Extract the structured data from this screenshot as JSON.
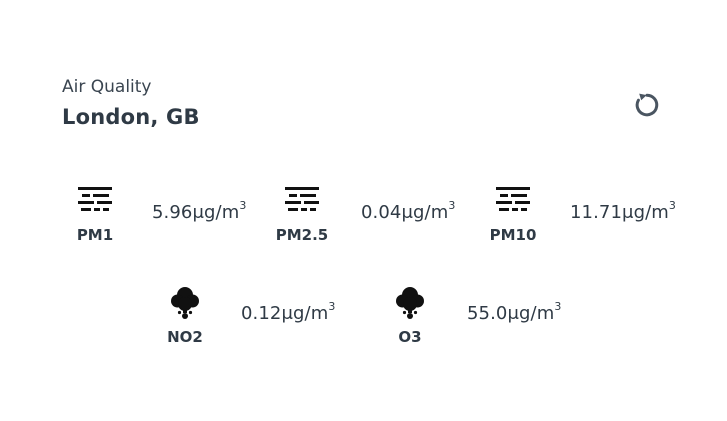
{
  "header": {
    "subtitle": "Air Quality",
    "location": "London, GB",
    "refresh_icon": "refresh-icon"
  },
  "metrics": [
    {
      "label": "PM1",
      "value": "5.96",
      "unit": "μg/m",
      "unit_sup": "3",
      "icon": "haze-icon"
    },
    {
      "label": "PM2.5",
      "value": "0.04",
      "unit": "μg/m",
      "unit_sup": "3",
      "icon": "haze-icon"
    },
    {
      "label": "PM10",
      "value": "11.71",
      "unit": "μg/m",
      "unit_sup": "3",
      "icon": "haze-icon"
    },
    {
      "label": "NO2",
      "value": "0.12",
      "unit": "μg/m",
      "unit_sup": "3",
      "icon": "smoke-cloud-icon"
    },
    {
      "label": "O3",
      "value": "55.0",
      "unit": "μg/m",
      "unit_sup": "3",
      "icon": "smoke-cloud-icon"
    }
  ],
  "colors": {
    "text": "#2f3a45",
    "icon": "#111111",
    "refresh": "#4a5561",
    "background": "#ffffff"
  }
}
